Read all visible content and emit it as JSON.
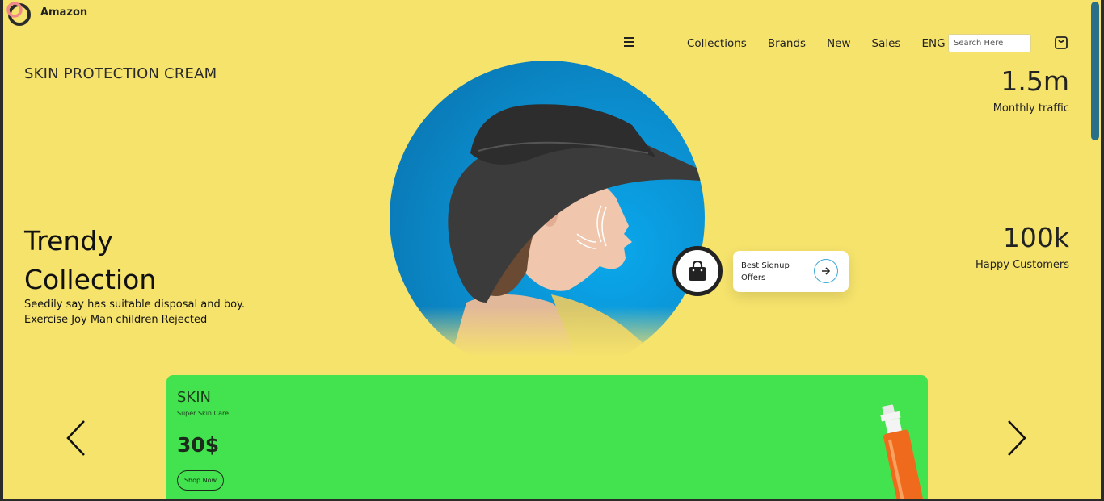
{
  "brand": {
    "name": "Amazon"
  },
  "nav": {
    "items": [
      "Collections",
      "Brands",
      "New",
      "Sales",
      "ENG"
    ],
    "search_placeholder": "Search Here"
  },
  "hero": {
    "subtitle": "SKIN PROTECTION CREAM",
    "title_line1": "Trendy",
    "title_line2": "Collection",
    "desc_line1": "Seedily say has suitable disposal and boy.",
    "desc_line2": "Exercise Joy Man children Rejected"
  },
  "stats": [
    {
      "value": "1.5m",
      "label": "Monthly traffic"
    },
    {
      "value": "100k",
      "label": "Happy Customers"
    }
  ],
  "offer": {
    "line1": "Best Signup",
    "line2": "Offers"
  },
  "product_card": {
    "title": "SKIN",
    "subtitle": "Super Skin Care",
    "price": "30$",
    "button": "Shop Now"
  },
  "colors": {
    "page_bg": "#f6e36c",
    "card_bg": "#42e34e",
    "circle_blue": "#0b8fd0",
    "scroll_thumb": "#2a6f88"
  },
  "icons": [
    "logo-icon",
    "menu-icon",
    "cart-icon",
    "shopping-bag-icon",
    "arrow-right-icon",
    "chevron-left-icon",
    "chevron-right-icon"
  ]
}
